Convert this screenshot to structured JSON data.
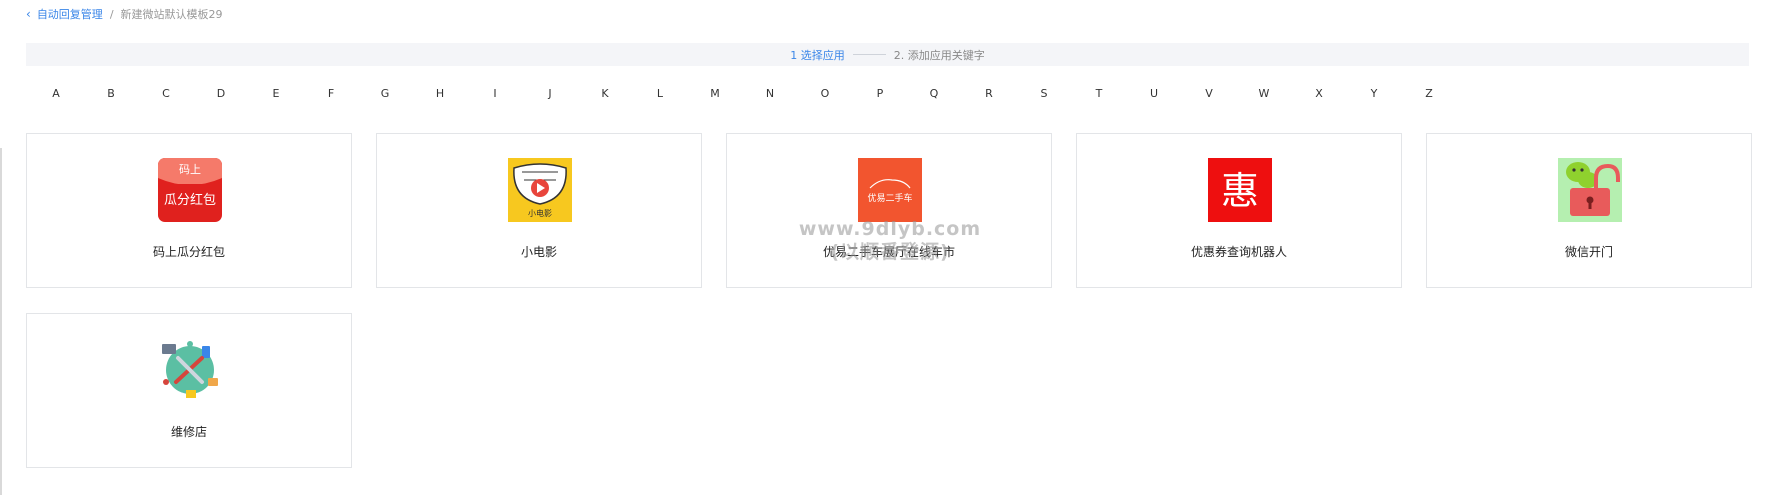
{
  "breadcrumb": {
    "back_label": "自动回复管理",
    "separator": "/",
    "current": "新建微站默认模板29"
  },
  "steps": {
    "step1": "1 选择应用",
    "step2": "2. 添加应用关键字"
  },
  "alphabet": [
    "A",
    "B",
    "C",
    "D",
    "E",
    "F",
    "G",
    "H",
    "I",
    "J",
    "K",
    "L",
    "M",
    "N",
    "O",
    "P",
    "Q",
    "R",
    "S",
    "T",
    "U",
    "V",
    "W",
    "X",
    "Y",
    "Z"
  ],
  "apps": [
    {
      "name": "码上瓜分红包",
      "icon": "red-envelope-icon",
      "icon_top": "码上",
      "icon_main": "瓜分红包"
    },
    {
      "name": "小电影",
      "icon": "movie-icon",
      "icon_text": "小电影"
    },
    {
      "name": "优易二手车展厅在线车市",
      "icon": "used-car-icon",
      "icon_text": "优易二手车"
    },
    {
      "name": "优惠券查询机器人",
      "icon": "coupon-icon",
      "icon_text": "惠"
    },
    {
      "name": "微信开门",
      "icon": "wechat-unlock-icon"
    },
    {
      "name": "维修店",
      "icon": "repair-shop-icon"
    }
  ],
  "watermark": {
    "line1": "www.9dlyb.com",
    "line2": "(以顺番登源)"
  },
  "colors": {
    "accent": "#3a86e8",
    "card_border": "#e3e5e8",
    "step_bg": "#f4f5f8"
  }
}
